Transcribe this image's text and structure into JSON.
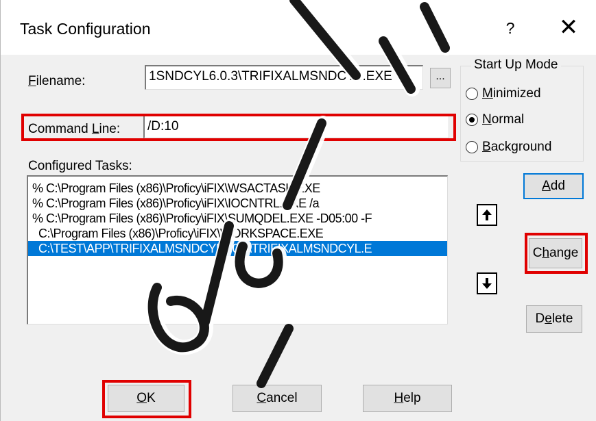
{
  "dialog": {
    "title": "Task Configuration",
    "help_glyph": "?",
    "close_glyph": "✕"
  },
  "filename": {
    "label_prefix": "",
    "label_mnemonic": "F",
    "label_rest": "ilename:",
    "value": "1SNDCYL6.0.3\\TRIFIXALMSNDCYL.EXE",
    "browse_label": "..."
  },
  "command_line": {
    "label_prefix": "Command ",
    "label_mnemonic": "L",
    "label_rest": "ine:",
    "value": "/D:10"
  },
  "startup_mode": {
    "title": "Start Up Mode",
    "options": [
      {
        "mnemonic": "M",
        "rest": "inimized",
        "selected": false
      },
      {
        "mnemonic": "N",
        "rest": "ormal",
        "selected": true
      },
      {
        "mnemonic": "B",
        "rest": "ackground",
        "selected": false
      }
    ]
  },
  "configured_tasks": {
    "label": "Configured Tasks:",
    "items": [
      "% C:\\Program Files (x86)\\Proficy\\iFIX\\WSACTASK.EXE",
      "% C:\\Program Files (x86)\\Proficy\\iFIX\\IOCNTRL.EXE  /a",
      "% C:\\Program Files (x86)\\Proficy\\iFIX\\SUMQDEL.EXE  -D05:00 -F",
      "  C:\\Program Files (x86)\\Proficy\\iFIX\\WORKSPACE.EXE",
      "  C:\\TEST\\APP\\TRIFIXALMSNDCYL6.0.3\\TRIFIXALMSNDCYL.E"
    ],
    "selected_index": 4
  },
  "buttons": {
    "add": {
      "mnemonic": "A",
      "rest": "dd"
    },
    "change": {
      "prefix": "C",
      "mnemonic": "h",
      "rest": "ange"
    },
    "delete": {
      "prefix": "D",
      "mnemonic": "e",
      "rest": "lete"
    },
    "ok": {
      "mnemonic": "O",
      "rest": "K"
    },
    "cancel": {
      "mnemonic": "C",
      "rest": "ancel"
    },
    "help": {
      "mnemonic": "H",
      "rest": "elp"
    }
  },
  "colors": {
    "highlight": "#e00000",
    "selection": "#0078d7",
    "default_button_border": "#0078d7"
  }
}
